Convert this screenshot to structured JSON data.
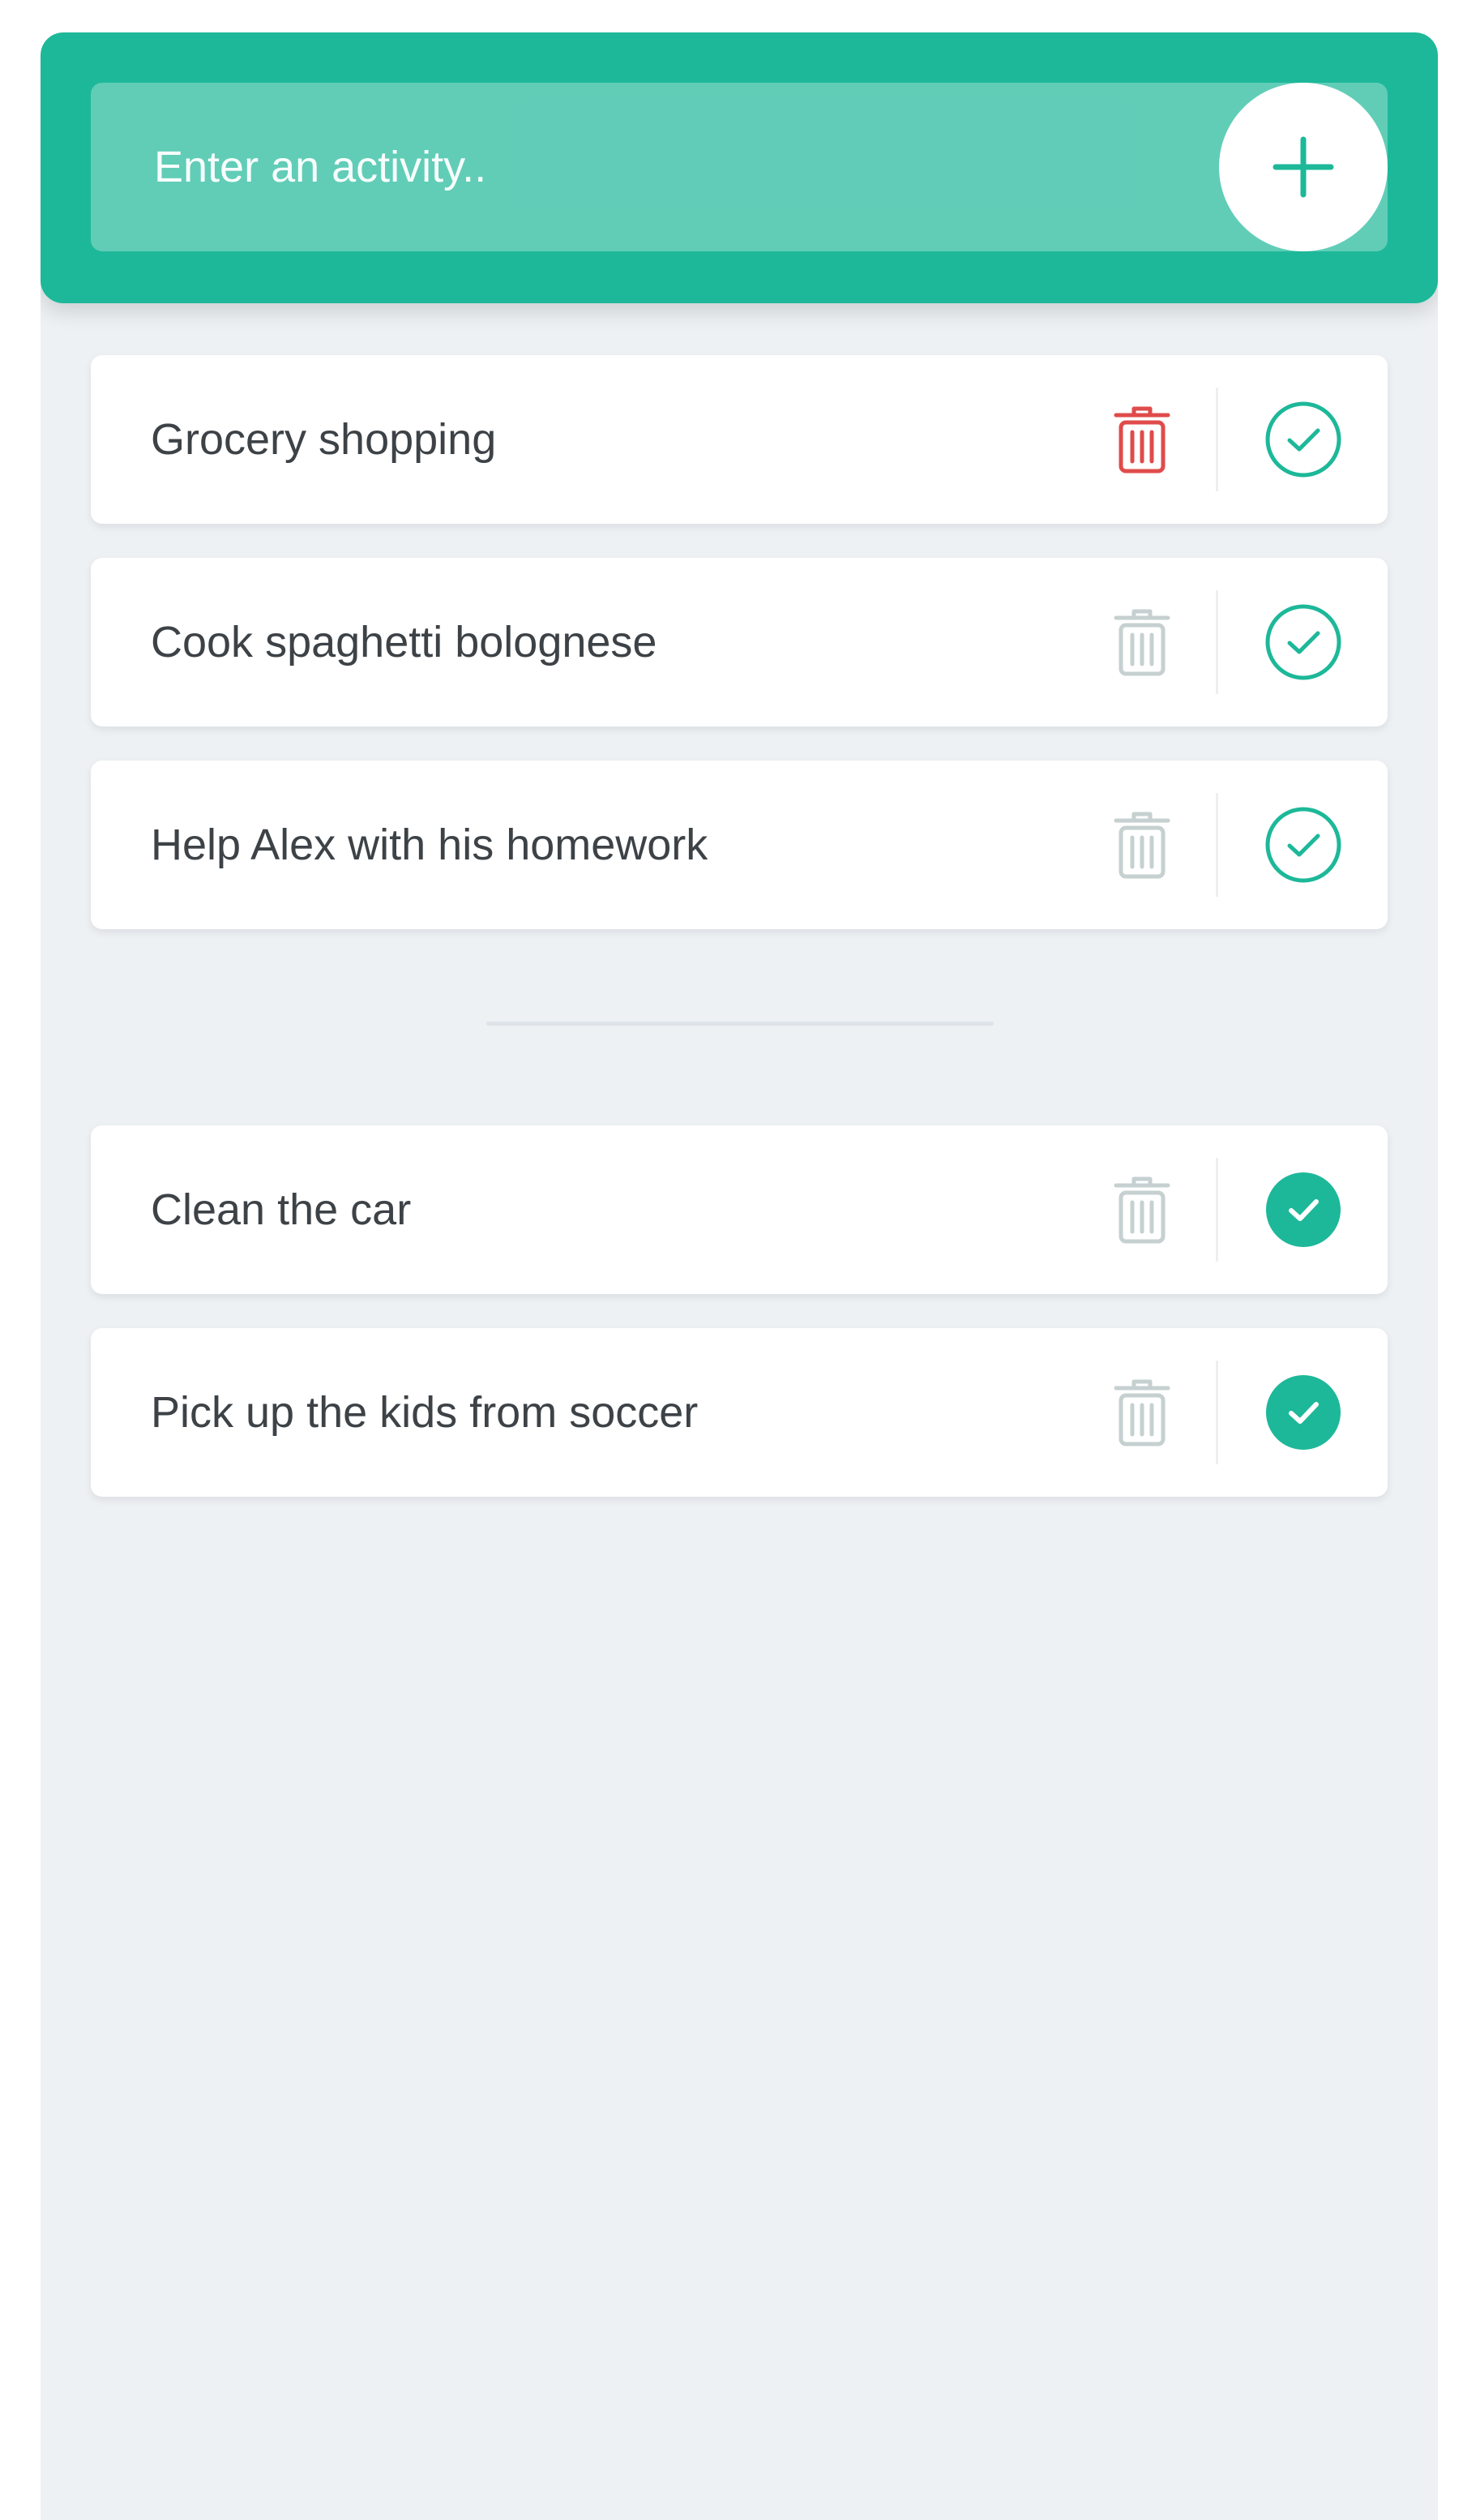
{
  "input": {
    "placeholder": "Enter an activity..",
    "value": ""
  },
  "add_button": {
    "icon": "plus-icon"
  },
  "todo_items": [
    {
      "text": "Grocery shopping",
      "completed": false,
      "delete_highlighted": true
    },
    {
      "text": "Cook spaghetti bolognese",
      "completed": false,
      "delete_highlighted": false
    },
    {
      "text": "Help Alex with his homework",
      "completed": false,
      "delete_highlighted": false
    }
  ],
  "completed_items": [
    {
      "text": "Clean the car",
      "completed": true,
      "delete_highlighted": false
    },
    {
      "text": "Pick up the kids from soccer",
      "completed": true,
      "delete_highlighted": false
    }
  ],
  "icons": {
    "delete": "trash-icon",
    "complete": "check-circle-icon"
  },
  "colors": {
    "accent": "#1db899",
    "background": "#edf1f4",
    "text": "#3d4247",
    "trash_active": "#e04b4b",
    "trash_inactive": "#c6d0d0"
  }
}
